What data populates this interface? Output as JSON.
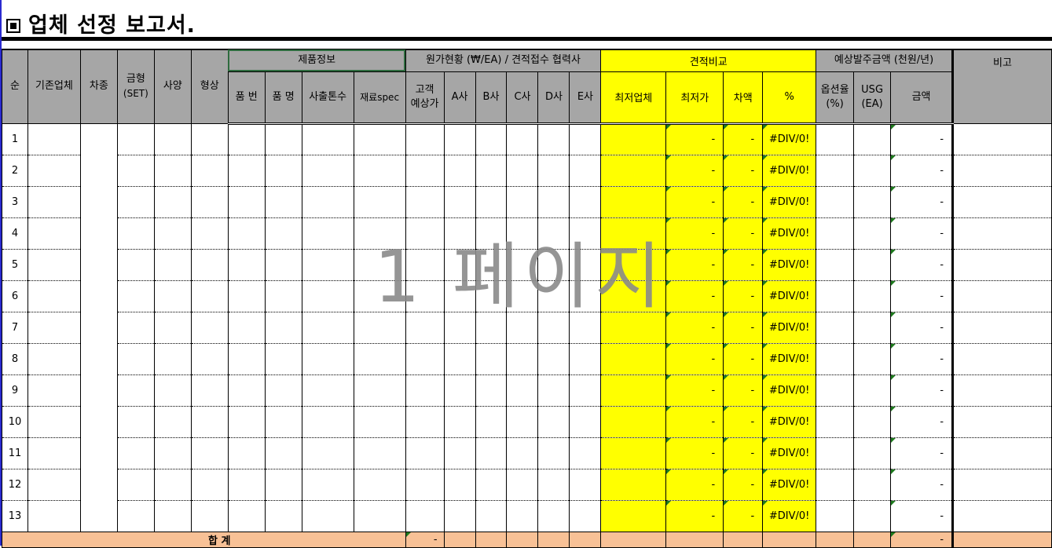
{
  "title": "업체 선정 보고서.",
  "title_icon": "square-bullet-icon",
  "watermark": "1 페이지",
  "header": {
    "seq": "순",
    "existing_vendor": "기존업체",
    "car_type": "차종",
    "mold_line1": "금형",
    "mold_line2": "(SET)",
    "spec": "사양",
    "shape": "형상",
    "product_info": "제품정보",
    "part_no": "품  번",
    "part_name": "품  명",
    "injection_tons": "사출톤수",
    "material_spec": "재료spec",
    "cost_status": "원가현황 (₩/EA) / 견적접수 협력사",
    "customer_line1": "고객",
    "customer_line2": "예상가",
    "vendor_a": "A사",
    "vendor_b": "B사",
    "vendor_c": "C사",
    "vendor_d": "D사",
    "vendor_e": "E사",
    "quote_compare": "견적비교",
    "lowest_vendor": "최저업체",
    "lowest_price": "최저가",
    "difference": "차액",
    "percent": "%",
    "order_amount": "예상발주금액 (천원/년)",
    "option_rate_line1": "옵션율",
    "option_rate_line2": "(%)",
    "usg_line1": "USG",
    "usg_line2": "(EA)",
    "amount": "금액",
    "remarks": "비고"
  },
  "rows": [
    {
      "no": "1",
      "lowest_price": "-",
      "difference": "-",
      "percent": "#DIV/0!",
      "amount": "-"
    },
    {
      "no": "2",
      "lowest_price": "-",
      "difference": "-",
      "percent": "#DIV/0!",
      "amount": "-"
    },
    {
      "no": "3",
      "lowest_price": "-",
      "difference": "-",
      "percent": "#DIV/0!",
      "amount": "-"
    },
    {
      "no": "4",
      "lowest_price": "-",
      "difference": "-",
      "percent": "#DIV/0!",
      "amount": "-"
    },
    {
      "no": "5",
      "lowest_price": "-",
      "difference": "-",
      "percent": "#DIV/0!",
      "amount": "-"
    },
    {
      "no": "6",
      "lowest_price": "-",
      "difference": "-",
      "percent": "#DIV/0!",
      "amount": "-"
    },
    {
      "no": "7",
      "lowest_price": "-",
      "difference": "-",
      "percent": "#DIV/0!",
      "amount": "-"
    },
    {
      "no": "8",
      "lowest_price": "-",
      "difference": "-",
      "percent": "#DIV/0!",
      "amount": "-"
    },
    {
      "no": "9",
      "lowest_price": "-",
      "difference": "-",
      "percent": "#DIV/0!",
      "amount": "-"
    },
    {
      "no": "10",
      "lowest_price": "-",
      "difference": "-",
      "percent": "#DIV/0!",
      "amount": "-"
    },
    {
      "no": "11",
      "lowest_price": "-",
      "difference": "-",
      "percent": "#DIV/0!",
      "amount": "-"
    },
    {
      "no": "12",
      "lowest_price": "-",
      "difference": "-",
      "percent": "#DIV/0!",
      "amount": "-"
    },
    {
      "no": "13",
      "lowest_price": "-",
      "difference": "-",
      "percent": "#DIV/0!",
      "amount": "-"
    }
  ],
  "total": {
    "label": "합      계",
    "customer_total": "-",
    "amount_total": "-"
  },
  "colors": {
    "header_gray": "#a6a6a6",
    "highlight_yellow": "#ffff00",
    "total_row": "#f8c196",
    "selection_green": "#2e6b3e"
  }
}
